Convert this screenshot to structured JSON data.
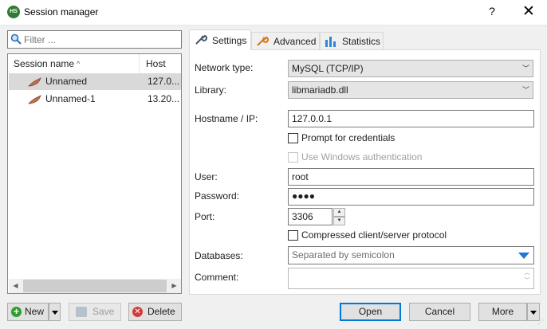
{
  "window": {
    "title": "Session manager",
    "help": "?",
    "close": "✕",
    "app_icon_text": "HS"
  },
  "filter": {
    "placeholder": "Filter ..."
  },
  "session_list": {
    "columns": [
      "Session name",
      "Host"
    ],
    "sort_indicator": "^",
    "rows": [
      {
        "name": "Unnamed",
        "host": "127.0...",
        "selected": true
      },
      {
        "name": "Unnamed-1",
        "host": "13.20...",
        "selected": false
      }
    ],
    "scroll_left": "◀",
    "scroll_right": "▶"
  },
  "left_buttons": {
    "new": "New",
    "save": "Save",
    "delete": "Delete"
  },
  "tabs": [
    {
      "label": "Settings",
      "icon": "wrench-icon",
      "active": true
    },
    {
      "label": "Advanced",
      "icon": "wrench-orange-icon",
      "active": false
    },
    {
      "label": "Statistics",
      "icon": "bar-chart-icon",
      "active": false
    }
  ],
  "settings": {
    "network_type": {
      "label": "Network type:",
      "value": "MySQL (TCP/IP)"
    },
    "library": {
      "label": "Library:",
      "value": "libmariadb.dll"
    },
    "hostname": {
      "label": "Hostname / IP:",
      "value": "127.0.0.1"
    },
    "prompt_credentials": {
      "label": "Prompt for credentials",
      "checked": false
    },
    "windows_auth": {
      "label": "Use Windows authentication",
      "checked": false,
      "disabled": true
    },
    "user": {
      "label": "User:",
      "value": "root"
    },
    "password": {
      "label": "Password:",
      "value": "●●●●"
    },
    "port": {
      "label": "Port:",
      "value": "3306"
    },
    "compressed": {
      "label": "Compressed client/server protocol",
      "checked": false
    },
    "databases": {
      "label": "Databases:",
      "placeholder": "Separated by semicolon"
    },
    "comment": {
      "label": "Comment:",
      "value": ""
    }
  },
  "bottom_buttons": {
    "open": "Open",
    "cancel": "Cancel",
    "more": "More"
  },
  "colors": {
    "accent": "#0078d7",
    "selected_row": "#d9d9d9",
    "dropdown_arrow": "#1e78d8"
  }
}
